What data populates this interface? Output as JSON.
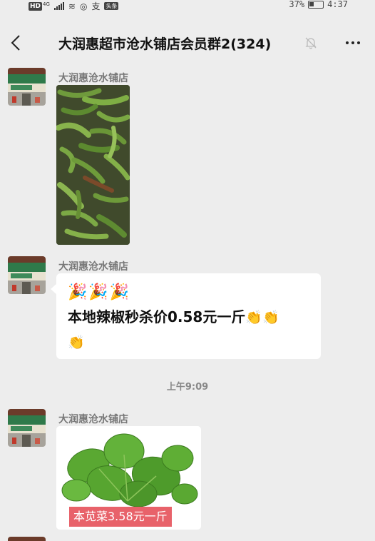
{
  "status_bar": {
    "hd": "HD",
    "net": "4G",
    "badge": "头条",
    "battery": "37%",
    "time": "4:37"
  },
  "header": {
    "title": "大润惠超市沧水铺店会员群2(324)"
  },
  "messages": [
    {
      "sender": "大润惠沧水铺店",
      "type": "image"
    },
    {
      "sender": "大润惠沧水铺店",
      "type": "text",
      "line1": "🎉🎉🎉",
      "line2": "本地辣椒秒杀价0.58元一斤",
      "hand_emoji": "👏"
    },
    {
      "sender": "大润惠沧水铺店",
      "type": "image",
      "image_text": "本苋菜3.58元一斤"
    }
  ],
  "time_separator": "上午9:09"
}
